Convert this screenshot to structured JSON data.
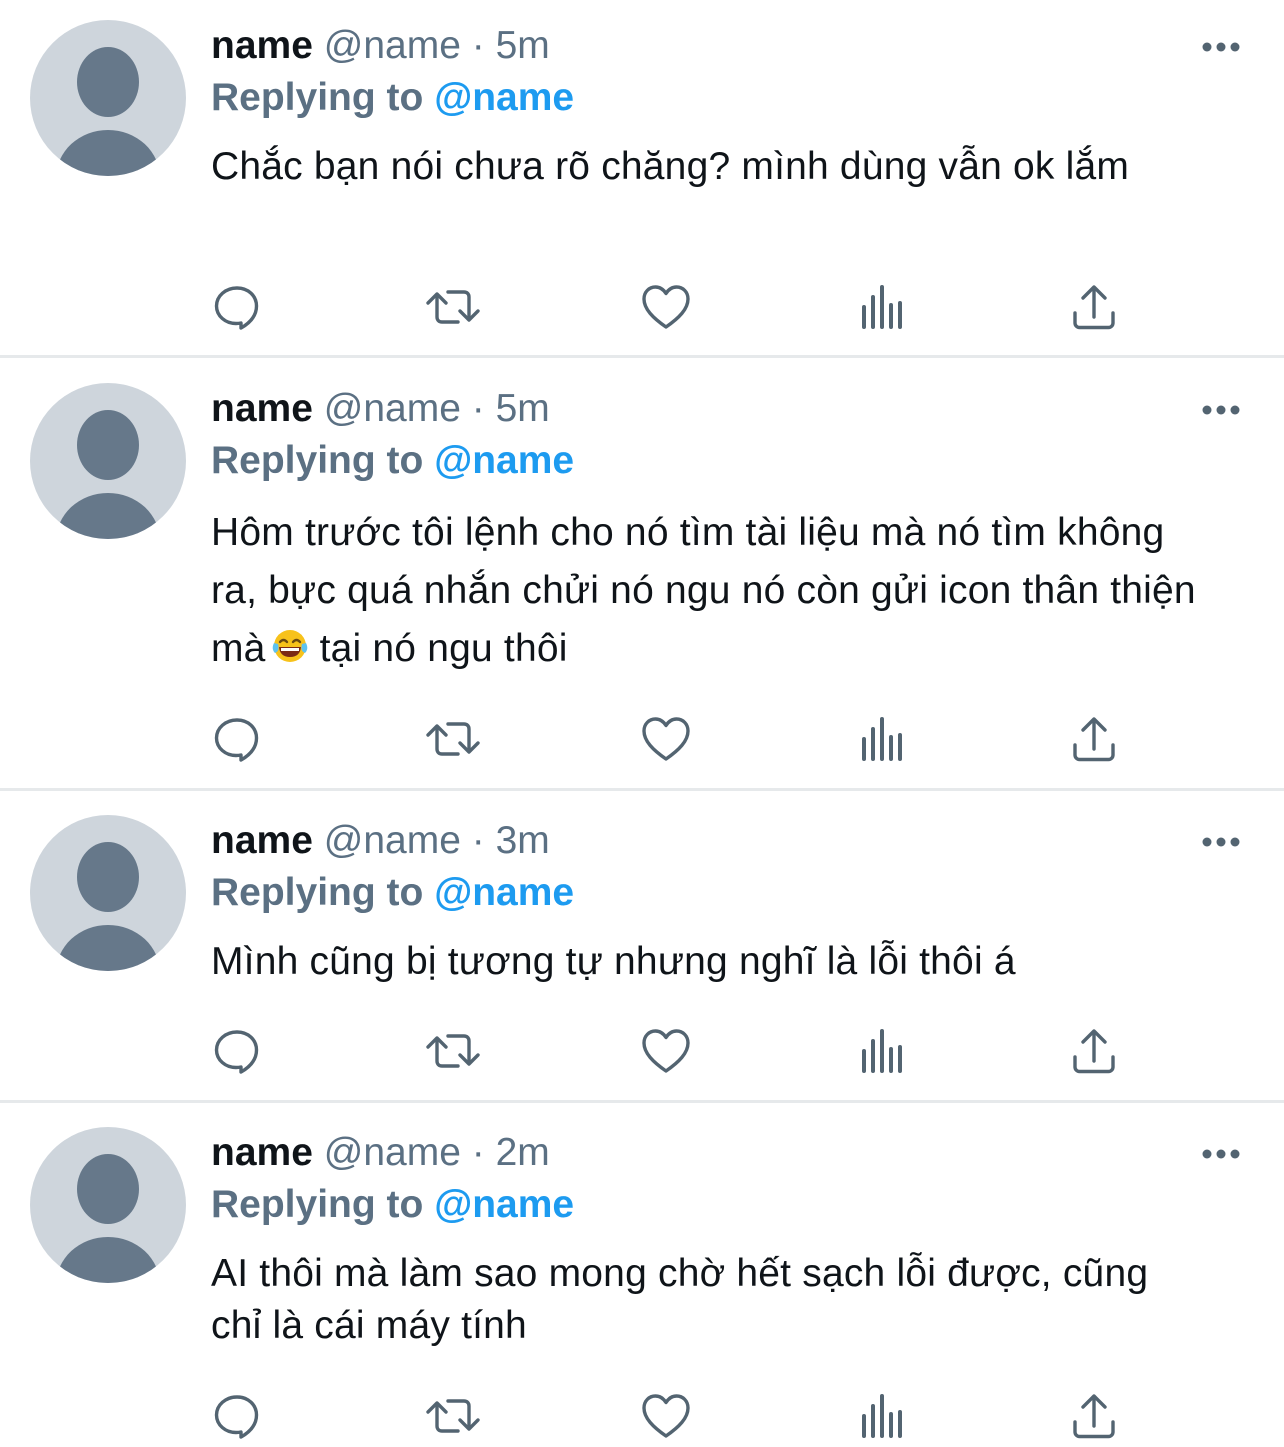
{
  "tweets": [
    {
      "name": "name",
      "handle": "@name",
      "dot": "·",
      "time": "5m",
      "replying_prefix": "Replying to",
      "replying_mention": "@name",
      "text_parts": [
        "Chắc bạn nói chưa rõ chăng? mình dùng vẫn ok lắm"
      ]
    },
    {
      "name": "name",
      "handle": "@name",
      "dot": "·",
      "time": "5m",
      "replying_prefix": "Replying to",
      "replying_mention": "@name",
      "text_parts": [
        "Hôm trước tôi lệnh cho nó tìm tài liệu mà nó tìm không ra, bực quá nhắn chửi nó ngu nó còn gửi icon thân thiện mà",
        "tại nó ngu thôi"
      ],
      "emoji": "face-with-tears-of-joy-emoji"
    },
    {
      "name": "name",
      "handle": "@name",
      "dot": "·",
      "time": "3m",
      "replying_prefix": "Replying to",
      "replying_mention": "@name",
      "text_parts": [
        "Mình cũng bị tương tự nhưng nghĩ là lỗi thôi á"
      ]
    },
    {
      "name": "name",
      "handle": "@name",
      "dot": "·",
      "time": "2m",
      "replying_prefix": "Replying to",
      "replying_mention": "@name",
      "text_parts": [
        "AI thôi mà làm sao mong chờ hết sạch lỗi được, cũng chỉ là cái máy tính"
      ]
    }
  ],
  "action_icons": [
    "reply-icon",
    "retweet-icon",
    "like-icon",
    "analytics-icon",
    "share-icon"
  ],
  "colors": {
    "text": "#0f1419",
    "secondary": "#5b7083",
    "mention": "#1d9bf0",
    "avatar_bg": "#ced5dc",
    "avatar_fg": "#66788a",
    "divider": "#e6e9eb",
    "icon": "#536471"
  }
}
